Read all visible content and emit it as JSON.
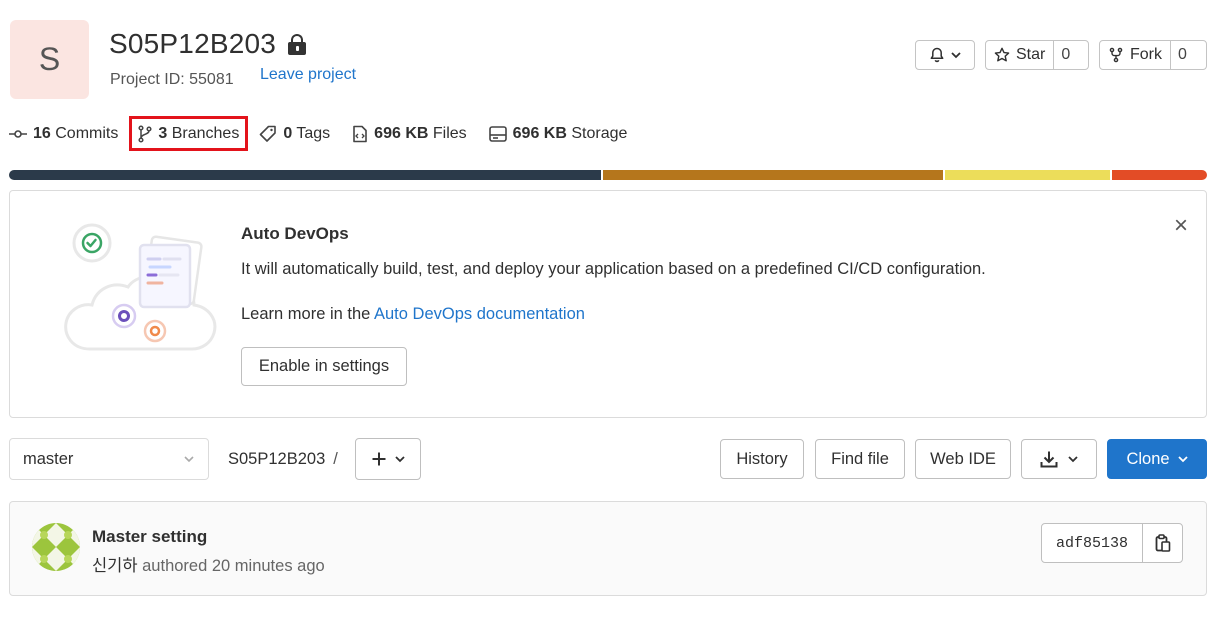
{
  "project": {
    "avatar_letter": "S",
    "name": "S05P12B203",
    "id_text": "Project ID: 55081",
    "leave_label": "Leave project"
  },
  "header_buttons": {
    "star_label": "Star",
    "star_count": "0",
    "fork_label": "Fork",
    "fork_count": "0"
  },
  "stats": {
    "commits": {
      "count": "16",
      "label": "Commits"
    },
    "branches": {
      "count": "3",
      "label": "Branches"
    },
    "tags": {
      "count": "0",
      "label": "Tags"
    },
    "files": {
      "count": "696 KB",
      "label": "Files"
    },
    "storage": {
      "count": "696 KB",
      "label": "Storage"
    }
  },
  "language_bar": [
    {
      "color": "#2b3a4a",
      "share": 0.497
    },
    {
      "color": "#b5761c",
      "share": 0.285
    },
    {
      "color": "#ecdd5a",
      "share": 0.138
    },
    {
      "color": "#e34c26",
      "share": 0.08
    }
  ],
  "devops": {
    "title": "Auto DevOps",
    "description": "It will automatically build, test, and deploy your application based on a predefined CI/CD configuration.",
    "learn_prefix": "Learn more in the ",
    "learn_link": "Auto DevOps documentation",
    "enable_label": "Enable in settings"
  },
  "repo_toolbar": {
    "branch": "master",
    "path_root": "S05P12B203",
    "path_sep": "/",
    "history_label": "History",
    "find_file_label": "Find file",
    "web_ide_label": "Web IDE",
    "clone_label": "Clone"
  },
  "last_commit": {
    "title": "Master setting",
    "author": "신기하",
    "authored_text": " authored 20 minutes ago",
    "sha": "adf85138"
  },
  "colors": {
    "link": "#1f75cb",
    "clone_button": "#1f75cb",
    "highlight_box": "#e3131b",
    "avatar_bg": "#fbe5e1"
  }
}
